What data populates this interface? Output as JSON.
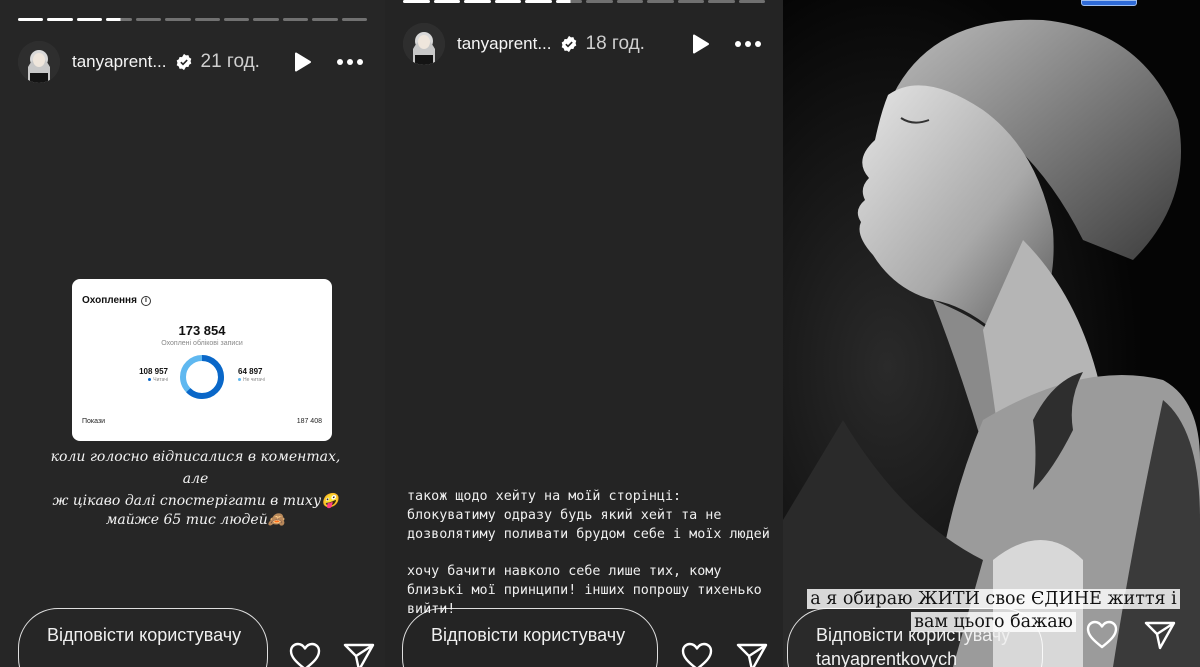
{
  "stories": [
    {
      "username": "tanyaprent...",
      "time": "21 год.",
      "reach_card": {
        "title": "Охоплення",
        "total": "173 854",
        "subtitle": "Охоплені облікові записи",
        "followers_value": "108 957",
        "followers_label": "Читачі",
        "non_followers_value": "64 897",
        "non_followers_label": "Не читачі",
        "followers_share": 0.627,
        "impressions_label": "Покази",
        "impressions_value": "187 408"
      },
      "caption_line1": "коли голосно відписалися в коментах, але",
      "caption_line2": "ж цікаво далі спостерігати в тиху🤪",
      "caption_line3": "майже 65 тис людей🙈",
      "reply_placeholder": "Відповісти користувачу"
    },
    {
      "username": "tanyaprent...",
      "time": "18 год.",
      "text_block1": "також щодо хейту на моїй сторінці: блокуватиму одразу будь який хейт та не дозволятиму поливати брудом себе і моїх людей",
      "text_block2": "хочу бачити навколо себе лише тих, кому близькі мої принципи! інших попрошу тихенько вийти!",
      "reply_placeholder": "Відповісти користувачу"
    },
    {
      "overlay_line1": "а я обираю ЖИТИ своє ЄДИНЕ життя і",
      "overlay_line2": "вам цього бажаю",
      "reply_placeholder": "Відповісти користувачу tanyaprentkovych"
    }
  ],
  "icons": {
    "verified": "verified-badge-icon",
    "play": "play-icon",
    "more": "more-options-icon",
    "like": "heart-icon",
    "share": "send-icon",
    "info": "info-icon"
  },
  "colors": {
    "story_bg": "#262626",
    "donut_followers": "#0a67c8",
    "donut_non_followers": "#5fb8f0"
  }
}
